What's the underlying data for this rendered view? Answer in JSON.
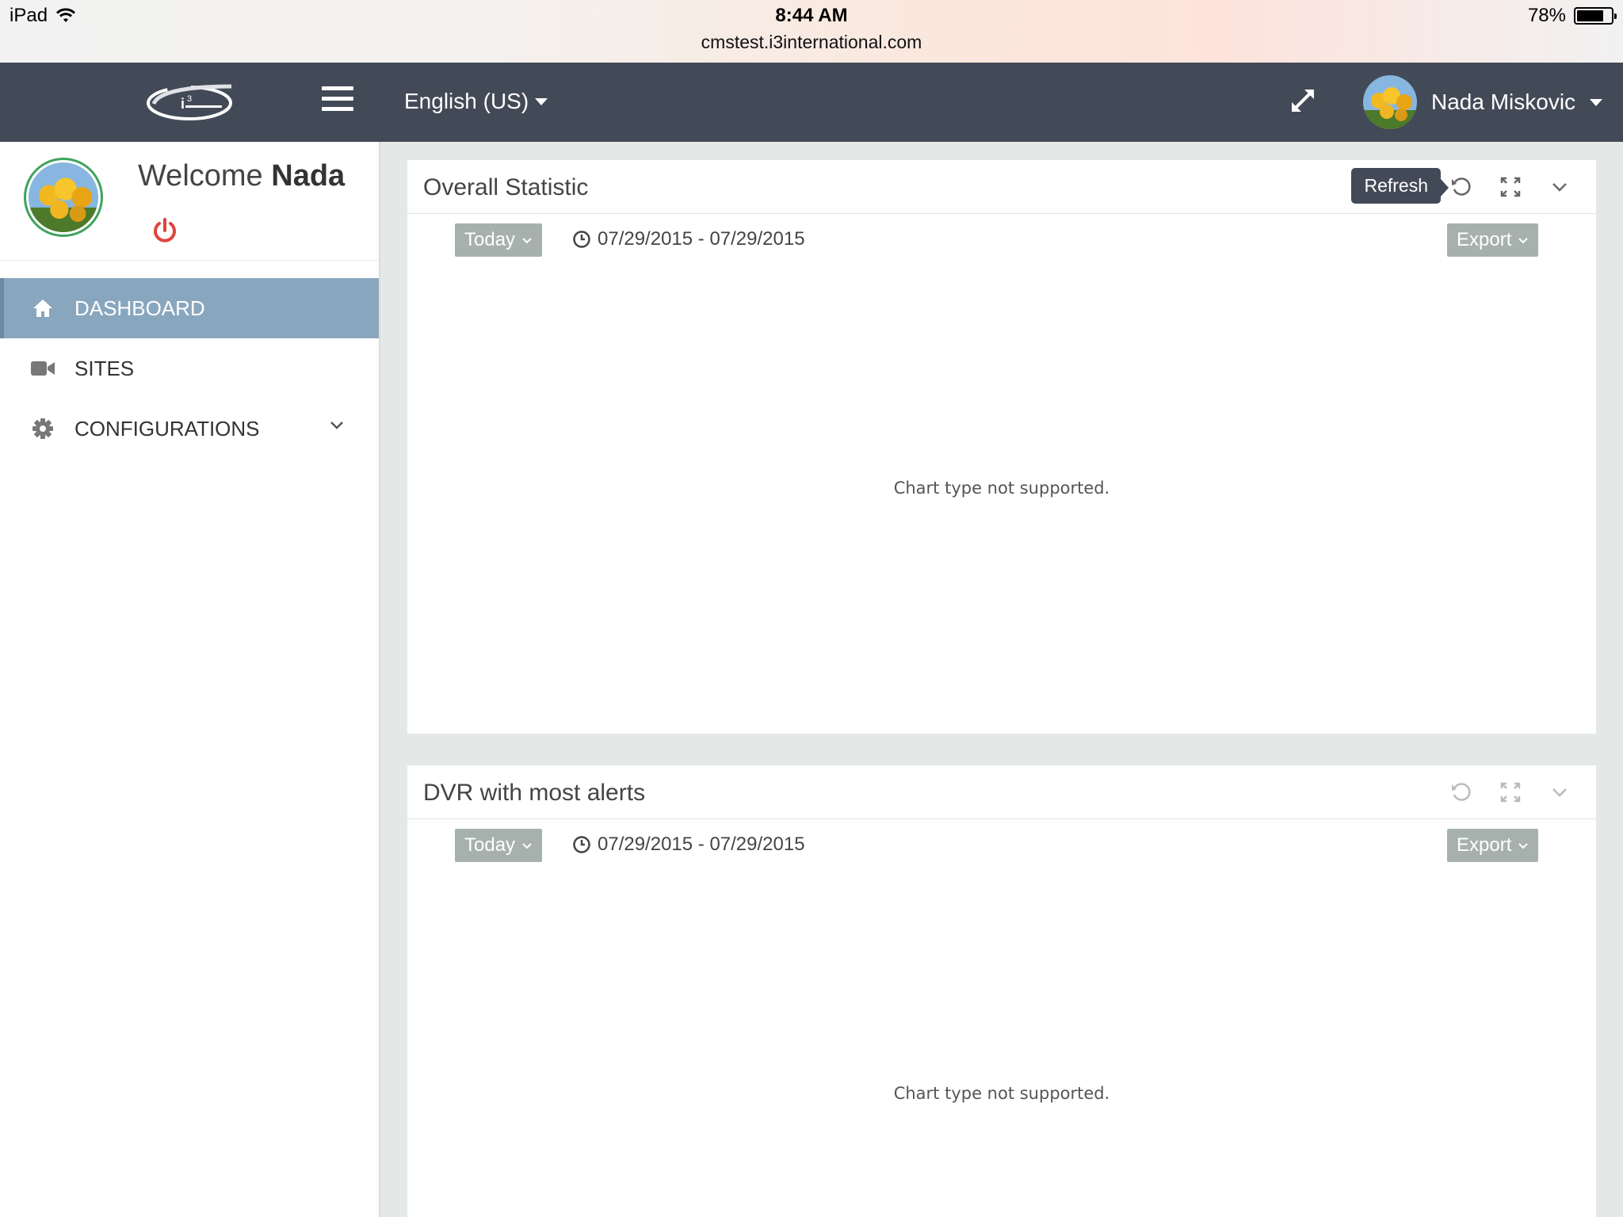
{
  "status_bar": {
    "device": "iPad",
    "time": "8:44 AM",
    "url": "cmstest.i3international.com",
    "battery": "78%",
    "battery_level": 0.78
  },
  "navbar": {
    "language": "English (US)",
    "user_name": "Nada Miskovic"
  },
  "sidebar": {
    "welcome_prefix": "Welcome",
    "welcome_name": "Nada",
    "items": [
      {
        "label": "DASHBOARD",
        "icon": "home-icon",
        "active": true
      },
      {
        "label": "SITES",
        "icon": "video-camera-icon",
        "active": false
      },
      {
        "label": "CONFIGURATIONS",
        "icon": "gear-icon",
        "active": false
      }
    ]
  },
  "panels": [
    {
      "title": "Overall Statistic",
      "period": "Today",
      "date_range": "07/29/2015 - 07/29/2015",
      "export": "Export",
      "message": "Chart type not supported.",
      "tooltip": "Refresh"
    },
    {
      "title": "DVR with most alerts",
      "period": "Today",
      "date_range": "07/29/2015 - 07/29/2015",
      "export": "Export",
      "message": "Chart type not supported."
    }
  ],
  "colors": {
    "navbar": "#434a57",
    "active_menu": "#89a6bf",
    "button": "#a6b1ad",
    "power": "#e0443e",
    "avatar_ring": "#3fa35d"
  }
}
